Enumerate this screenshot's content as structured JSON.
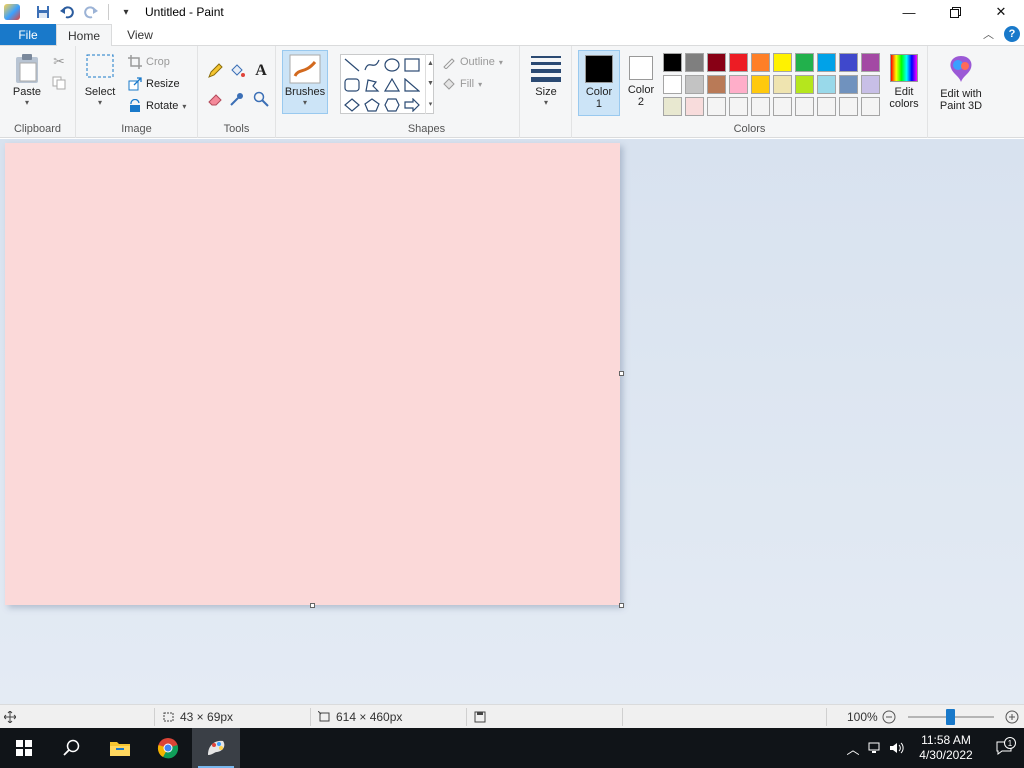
{
  "window": {
    "title": "Untitled - Paint"
  },
  "tabs": {
    "file": "File",
    "home": "Home",
    "view": "View"
  },
  "clipboard": {
    "paste": "Paste",
    "label": "Clipboard"
  },
  "image": {
    "select": "Select",
    "crop": "Crop",
    "resize": "Resize",
    "rotate": "Rotate",
    "label": "Image"
  },
  "tools": {
    "label": "Tools",
    "text_glyph": "A"
  },
  "brushes": {
    "label": "Brushes"
  },
  "shapes": {
    "outline": "Outline",
    "fill": "Fill",
    "label": "Shapes"
  },
  "size": {
    "label": "Size"
  },
  "colors": {
    "color1_label": "Color\n1",
    "color2_label": "Color\n2",
    "edit_colors": "Edit colors",
    "label": "Colors",
    "color1_value": "#000000",
    "color2_value": "#ffffff",
    "palette": [
      "#000000",
      "#7f7f7f",
      "#880015",
      "#ed1c24",
      "#ff7f27",
      "#fff200",
      "#22b14c",
      "#00a2e8",
      "#3f48cc",
      "#a349a4",
      "#ffffff",
      "#c3c3c3",
      "#b97a57",
      "#ffaec9",
      "#ffc90e",
      "#efe4b0",
      "#b5e61d",
      "#99d9ea",
      "#7092be",
      "#c8bfe7",
      "#e8e8d0",
      "#f8dcdc",
      "#f4f4f4",
      "#f4f4f4",
      "#f4f4f4",
      "#f4f4f4",
      "#f4f4f4",
      "#f4f4f4",
      "#f4f4f4",
      "#f4f4f4"
    ]
  },
  "paint3d": {
    "label": "Edit with Paint 3D"
  },
  "canvas": {
    "background": "#fbd9d9"
  },
  "status": {
    "selection_size": "43 × 69px",
    "image_size": "614 × 460px",
    "zoom": "100%"
  },
  "taskbar": {
    "time": "11:58 AM",
    "date": "4/30/2022",
    "notification_count": "1"
  }
}
